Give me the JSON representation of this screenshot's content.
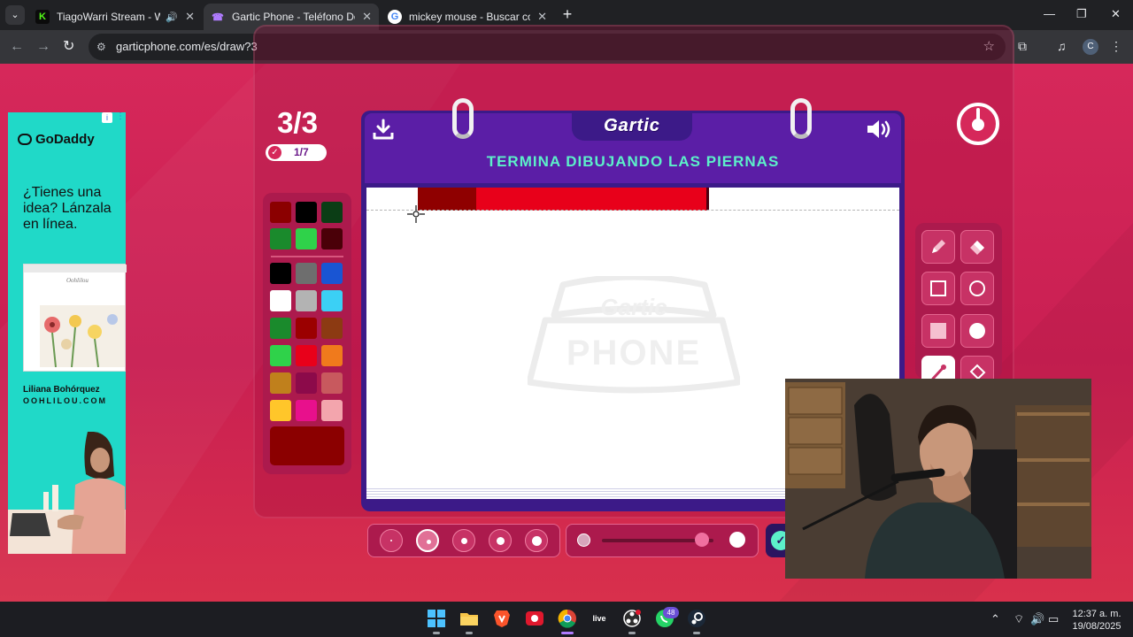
{
  "browser": {
    "tabs": [
      {
        "title": "TiagoWarri Stream - Watch",
        "favicon": "kick-icon",
        "favicon_color": "#53fc18",
        "active": false,
        "audio": true
      },
      {
        "title": "Gartic Phone - Teléfono Descon",
        "favicon": "gartic-phone-icon",
        "favicon_color": "#b07cff",
        "active": true,
        "audio": false
      },
      {
        "title": "mickey mouse - Buscar con Goo",
        "favicon": "google-icon",
        "favicon_color": "#4285f4",
        "active": false,
        "audio": false
      }
    ],
    "new_tab": "+",
    "window_controls": {
      "minimize": "—",
      "maximize": "❐",
      "close": "✕"
    },
    "url": "garticphone.com/es/draw?3",
    "profile_initial": "C"
  },
  "game": {
    "round": "3/3",
    "progress": "1/7",
    "logo": "Gartic",
    "prompt": "TERMINA DIBUJANDO LAS PIERNAS",
    "watermark_top": "Gartic",
    "watermark_bottom": "PHONE",
    "palette": [
      "#8b0000",
      "#000000",
      "#0b3d15",
      "#1a8a2c",
      "#2fd24a",
      "#4a0008",
      "#000000",
      "#6e6e6e",
      "#1955d3",
      "#ffffff",
      "#b3b3b3",
      "#3bd0f5",
      "#1a8a2c",
      "#9b0000",
      "#8c3a12",
      "#2fd24a",
      "#e8001a",
      "#f07a1c",
      "#c0801c",
      "#8c0a4a",
      "#c8595e",
      "#ffc62a",
      "#e8108c",
      "#f3a5ad"
    ],
    "current_color": "#8b0000",
    "tools": [
      "pencil-icon",
      "eraser-icon",
      "rectangle-outline-icon",
      "circle-outline-icon",
      "rectangle-filled-icon",
      "circle-filled-icon",
      "line-icon",
      "fill-bucket-icon"
    ],
    "active_tool": "line-icon",
    "brush_sizes": 5,
    "active_brush": 2,
    "opacity_level": 0.9
  },
  "ad": {
    "brand": "GoDaddy",
    "headline": "¿Tienes una idea? Lánzala en línea.",
    "mock_brand": "Oohlilou",
    "person_name": "Liliana Bohórquez",
    "site": "OOHLILOU.COM",
    "info": "i"
  },
  "taskbar": {
    "apps": [
      "windows-start-icon",
      "file-explorer-icon",
      "brave-icon",
      "app-red-icon",
      "chrome-icon",
      "live-icon",
      "obs-icon",
      "whatsapp-icon",
      "steam-icon"
    ],
    "live_label": "live",
    "whatsapp_badge": "48",
    "time": "12:37 a. m.",
    "date": "19/08/2025"
  }
}
